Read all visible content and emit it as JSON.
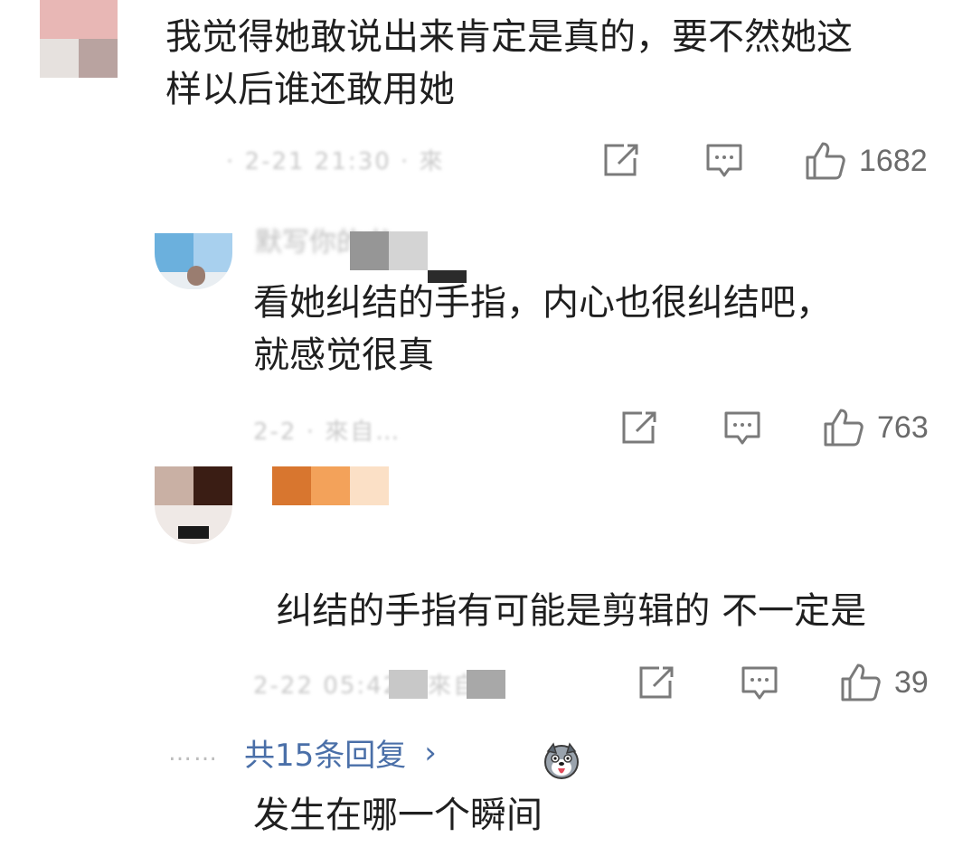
{
  "comments": [
    {
      "text": "我觉得她敢说出来肯定是真的，要不然她这\n样以后谁还敢用她",
      "meta": "·  2-21 21:30 · 來",
      "likes": "1682"
    },
    {
      "author": "默写你的书",
      "text": "看她纠结的手指，内心也很纠结吧，\n就感觉很真",
      "meta": "2-2  · 來自…",
      "likes": "763"
    },
    {
      "author": "",
      "text": "纠结的手指有可能是剪辑的 不一定是\n发生在哪一个瞬间",
      "meta": "2-22 05:42 · 來自",
      "likes": "39"
    }
  ],
  "footer": {
    "dots": "……",
    "more_replies": "共15条回复",
    "chevron": "›"
  },
  "icons": [
    "share-icon",
    "reply-icon",
    "like-icon",
    "dog-emoji-icon"
  ],
  "colors": {
    "link": "#4a6fa8",
    "count": "#6b6b6b",
    "icon": "#7a7a7a"
  }
}
